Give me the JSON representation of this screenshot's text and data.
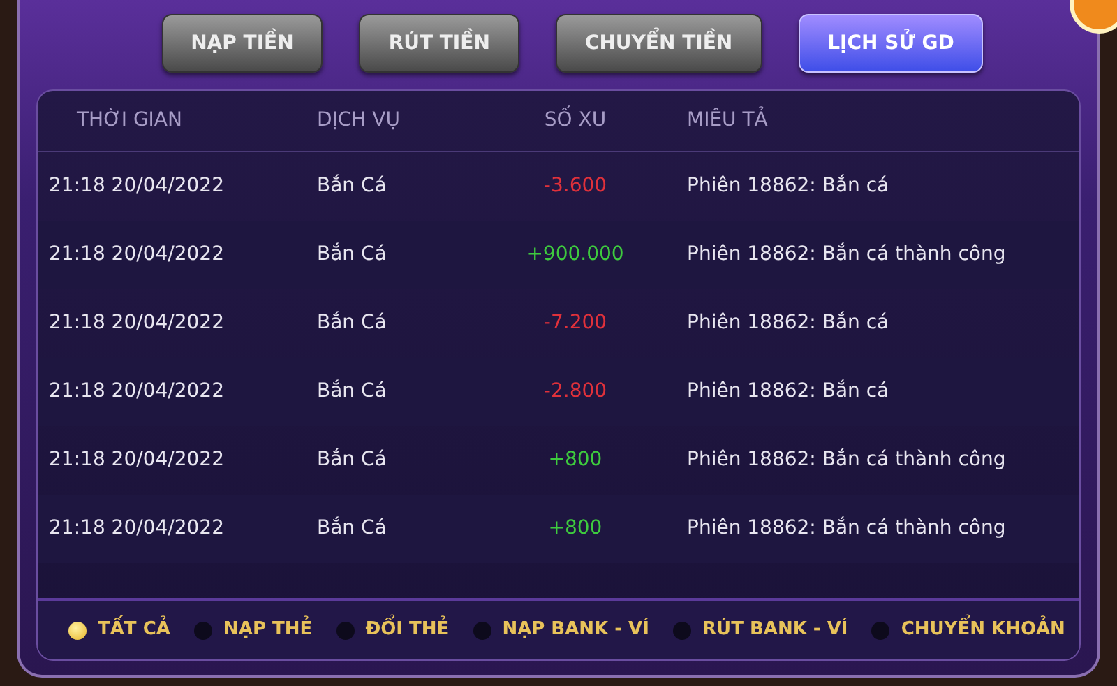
{
  "tabs": [
    {
      "label": "NẠP TIỀN",
      "selected": false
    },
    {
      "label": "RÚT TIỀN",
      "selected": false
    },
    {
      "label": "CHUYỂN TIỀN",
      "selected": false
    },
    {
      "label": "LỊCH SỬ GD",
      "selected": true
    }
  ],
  "table": {
    "columns": [
      "THỜI GIAN",
      "DỊCH VỤ",
      "SỐ XU",
      "MIÊU TẢ"
    ],
    "rows": [
      {
        "time": "21:18 20/04/2022",
        "service": "Bắn Cá",
        "amount": "-3.600",
        "kind": "debit",
        "description": "Phiên 18862: Bắn cá"
      },
      {
        "time": "21:18 20/04/2022",
        "service": "Bắn Cá",
        "amount": "+900.000",
        "kind": "credit",
        "description": "Phiên 18862: Bắn cá thành công"
      },
      {
        "time": "21:18 20/04/2022",
        "service": "Bắn Cá",
        "amount": "-7.200",
        "kind": "debit",
        "description": "Phiên 18862: Bắn cá"
      },
      {
        "time": "21:18 20/04/2022",
        "service": "Bắn Cá",
        "amount": "-2.800",
        "kind": "debit",
        "description": "Phiên 18862: Bắn cá"
      },
      {
        "time": "21:18 20/04/2022",
        "service": "Bắn Cá",
        "amount": "+800",
        "kind": "credit",
        "description": "Phiên 18862: Bắn cá thành công"
      },
      {
        "time": "21:18 20/04/2022",
        "service": "Bắn Cá",
        "amount": "+800",
        "kind": "credit",
        "description": "Phiên 18862: Bắn cá thành công"
      }
    ]
  },
  "filters": [
    {
      "label": "TẤT CẢ",
      "selected": true
    },
    {
      "label": "NẠP THẺ",
      "selected": false
    },
    {
      "label": "ĐỔI THẺ",
      "selected": false
    },
    {
      "label": "NẠP BANK - VÍ",
      "selected": false
    },
    {
      "label": "RÚT BANK - VÍ",
      "selected": false
    },
    {
      "label": "CHUYỂN KHOẢN",
      "selected": false
    }
  ]
}
